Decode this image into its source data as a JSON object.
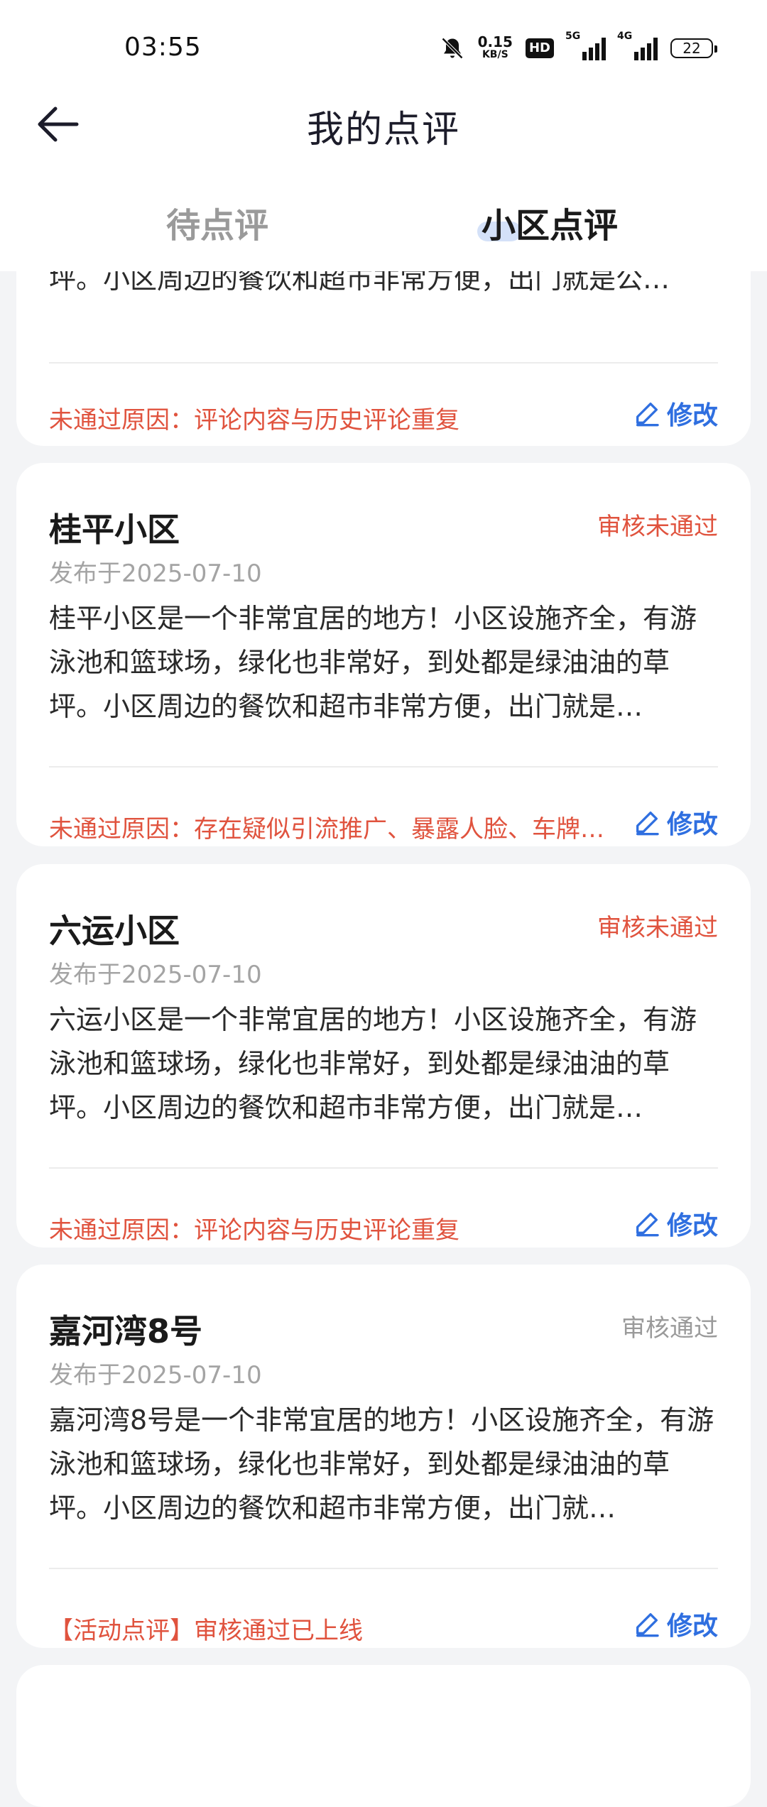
{
  "status_bar": {
    "time": "03:55",
    "net_speed_value": "0.15",
    "net_speed_unit": "KB/S",
    "hd_label": "HD",
    "signal1_label": "5G",
    "signal2_label": "4G",
    "battery": "22",
    "icons": [
      "mute-bell-icon",
      "hd-icon",
      "signal-5g-icon",
      "signal-4g-icon",
      "battery-icon"
    ]
  },
  "header": {
    "title": "我的点评",
    "back_icon": "arrow-left-icon"
  },
  "tabs": [
    {
      "label": "待点评",
      "active": false
    },
    {
      "label": "小区点评",
      "active": true
    }
  ],
  "colors": {
    "reject": "#e0533e",
    "approved": "#9a9a9a",
    "link": "#2f6fe0"
  },
  "reviews": [
    {
      "title": "",
      "status": "",
      "date": "",
      "text": "泳池和篮球场，绿化也非常好，到处都是绿油油的草坪。小区周边的餐饮和超市非常方便，出门就是公…",
      "note": "未通过原因：评论内容与历史评论重复",
      "edit_label": "修改"
    },
    {
      "title": "桂平小区",
      "status": "审核未通过",
      "date": "发布于2025-07-10",
      "text": "桂平小区是一个非常宜居的地方！小区设施齐全，有游泳池和篮球场，绿化也非常好，到处都是绿油油的草坪。小区周边的餐饮和超市非常方便，出门就是…",
      "note": "未通过原因：存在疑似引流推广、暴露人脸、车牌…",
      "edit_label": "修改"
    },
    {
      "title": "六运小区",
      "status": "审核未通过",
      "date": "发布于2025-07-10",
      "text": "六运小区是一个非常宜居的地方！小区设施齐全，有游泳池和篮球场，绿化也非常好，到处都是绿油油的草坪。小区周边的餐饮和超市非常方便，出门就是…",
      "note": "未通过原因：评论内容与历史评论重复",
      "edit_label": "修改"
    },
    {
      "title": "嘉河湾8号",
      "status": "审核通过",
      "date": "发布于2025-07-10",
      "text": "嘉河湾8号是一个非常宜居的地方！小区设施齐全，有游泳池和篮球场，绿化也非常好，到处都是绿油油的草坪。小区周边的餐饮和超市非常方便，出门就…",
      "note": "【活动点评】审核通过已上线",
      "edit_label": "修改"
    }
  ]
}
